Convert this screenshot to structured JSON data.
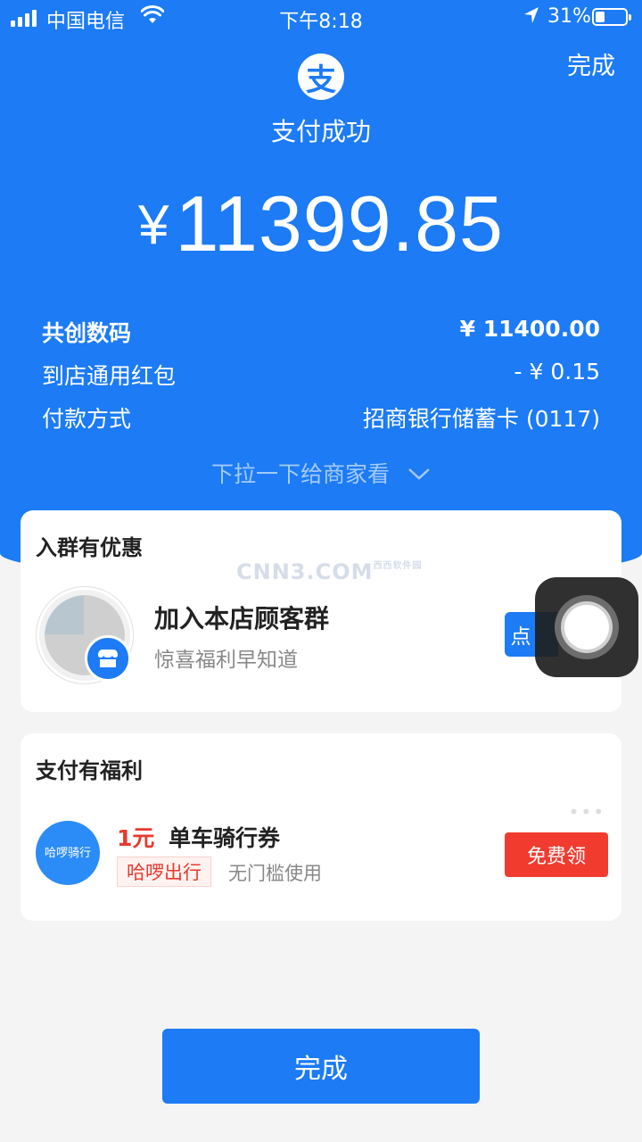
{
  "status_bar": {
    "carrier": "中国电信",
    "time": "下午8:18",
    "battery": "31%"
  },
  "header": {
    "done_label": "完成",
    "logo_glyph": "支",
    "title": "支付成功",
    "currency": "¥",
    "amount": "11399.85"
  },
  "details": [
    {
      "label": "共创数码",
      "value": "¥ 11400.00"
    },
    {
      "label": "到店通用红包",
      "value": "- ¥ 0.15"
    },
    {
      "label": "付款方式",
      "value": "招商银行储蓄卡 (0117)"
    }
  ],
  "pull_hint": "下拉一下给商家看",
  "group_card": {
    "title": "入群有优惠",
    "name": "加入本店顾客群",
    "subtitle": "惊喜福利早知道",
    "button_label": "点"
  },
  "welfare_card": {
    "title": "支付有福利",
    "logo_text": "哈啰骑行",
    "coupon_amount": "1元",
    "coupon_name": "单车骑行券",
    "brand_tag": "哈啰出行",
    "desc": "无门槛使用",
    "button_label": "免费领"
  },
  "watermark": {
    "main": "CNN3.COM",
    "small": "西西软件园"
  },
  "footer": {
    "done_label": "完成"
  },
  "colors": {
    "primary": "#1c7bf5",
    "accent_red": "#f23b2f",
    "page_bg": "#f4f4f4"
  }
}
